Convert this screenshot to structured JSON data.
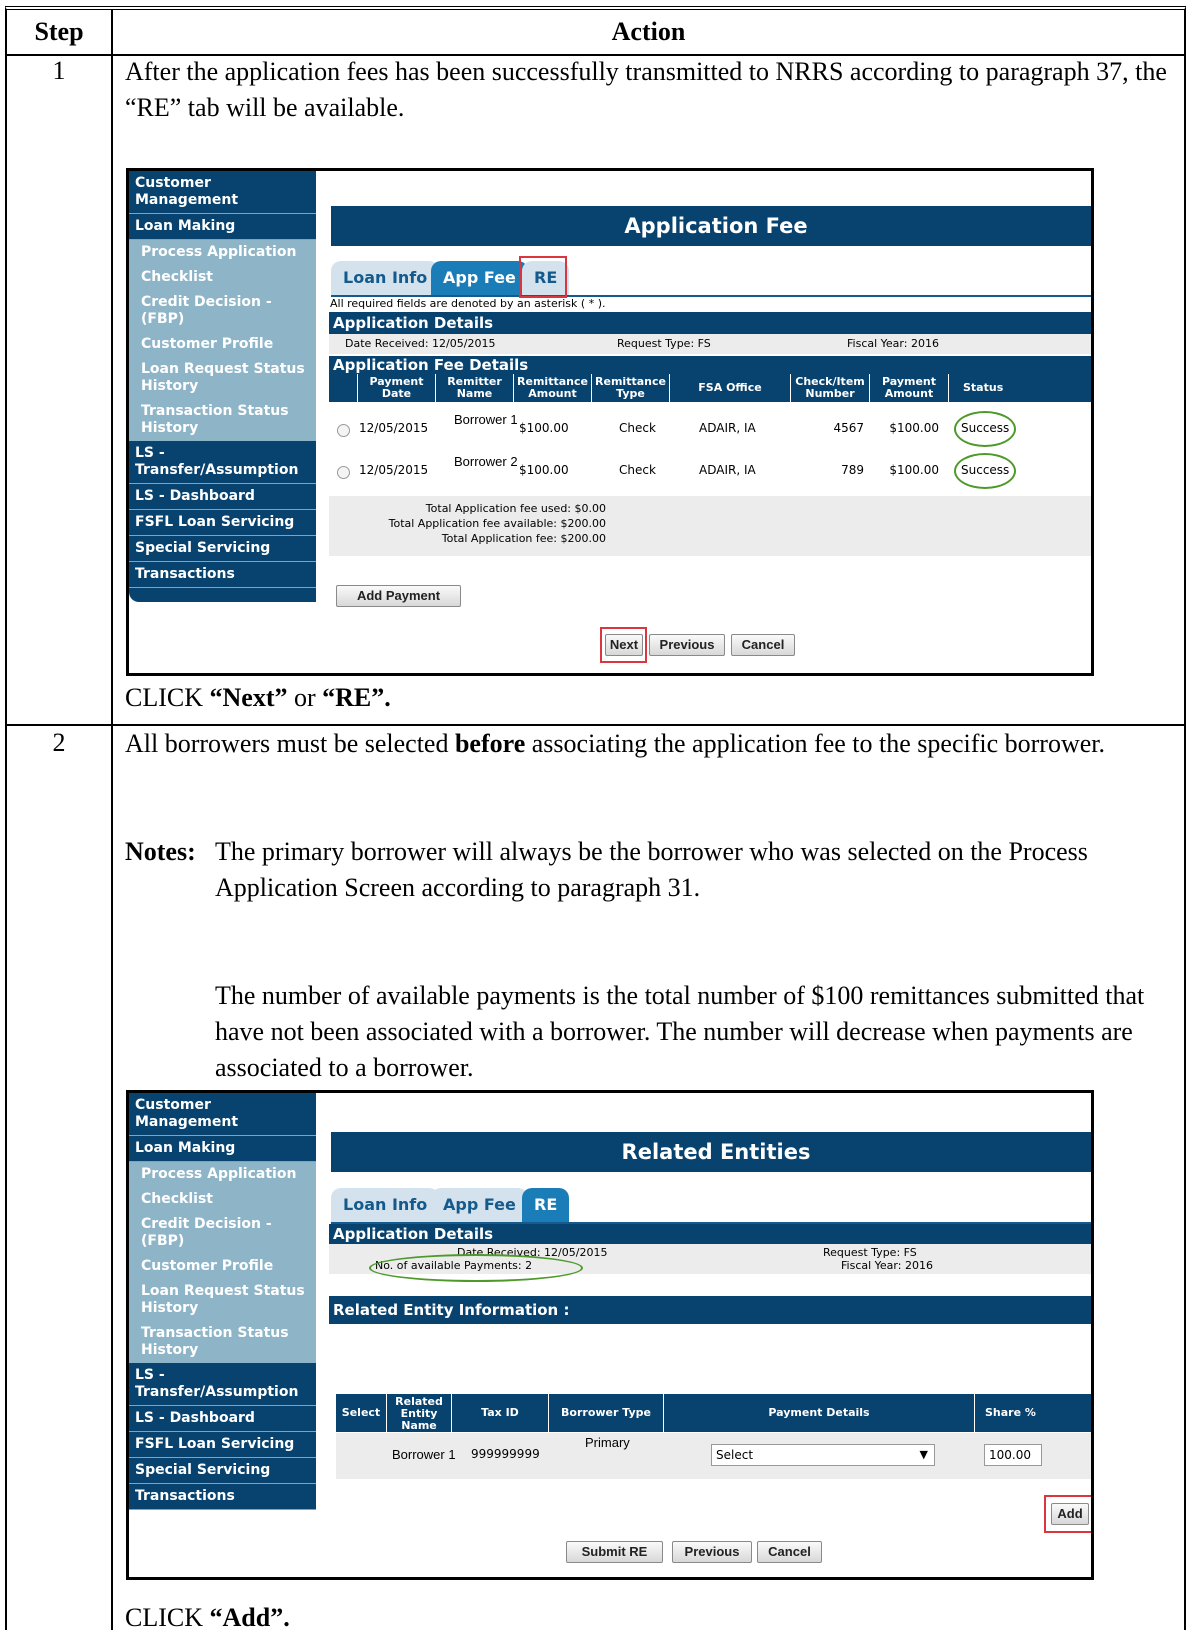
{
  "header": {
    "step": "Step",
    "action": "Action"
  },
  "step1": {
    "num": "1",
    "text": "After the application fees has been successfully transmitted to NRRS according to paragraph 37, the “RE” tab will be available.",
    "instr_prefix": "CLICK ",
    "instr_b1": "“Next”",
    "instr_mid": " or ",
    "instr_b2": "“RE”."
  },
  "step2": {
    "num": "2",
    "text_a": "All borrowers must be selected ",
    "text_b": "before",
    "text_c": " associating the application fee to the specific borrower.",
    "notes_label": "Notes:",
    "note1": "The primary borrower will always be the borrower who was selected on the Process Application Screen according to paragraph 31.",
    "note2": "The number of available payments is the total number of $100 remittances submitted that have not been associated with a borrower.  The number will decrease when payments are associated to a borrower.",
    "instr_prefix": "CLICK ",
    "instr_b": "“Add”."
  },
  "sidebar": {
    "customer_mgmt": "Customer Management",
    "loan_making": "Loan Making",
    "process_app": "Process Application",
    "checklist": "Checklist",
    "credit": "Credit Decision - (FBP)",
    "profile": "Customer Profile",
    "loan_req": "Loan Request Status History",
    "trans_status": "Transaction Status History",
    "ls_transfer": "LS - Transfer/Assumption",
    "ls_dash": "LS - Dashboard",
    "fsfl": "FSFL Loan Servicing",
    "special": "Special Servicing",
    "transactions": "Transactions"
  },
  "tabs": {
    "loan_info": "Loan Info",
    "app_fee": "App Fee",
    "re": "RE"
  },
  "screen1": {
    "title": "Application Fee",
    "required_note": "All required fields are denoted by an asterisk ( * ).",
    "app_details": "Application Details",
    "date_received": "Date Received:  12/05/2015",
    "request_type": "Request Type:  FS",
    "fiscal_year": "Fiscal Year:  2016",
    "fee_details": "Application Fee Details",
    "columns": [
      "Payment Date",
      "Remitter Name",
      "Remittance Amount",
      "Remittance Type",
      "FSA Office",
      "Check/Item Number",
      "Payment Amount",
      "Status"
    ],
    "rows": [
      [
        "12/05/2015",
        "Borrower 1",
        "$100.00",
        "Check",
        "ADAIR, IA",
        "4567",
        "$100.00",
        "Success"
      ],
      [
        "12/05/2015",
        "Borrower 2",
        "$100.00",
        "Check",
        "ADAIR, IA",
        "789",
        "$100.00",
        "Success"
      ]
    ],
    "total_used": "Total Application fee used: $0.00",
    "total_available": "Total Application fee available: $200.00",
    "total_fee": "Total Application fee: $200.00",
    "add_payment": "Add Payment",
    "next": "Next",
    "previous": "Previous",
    "cancel": "Cancel"
  },
  "screen2": {
    "title": "Related Entities",
    "app_details": "Application Details",
    "date_received": "Date Received: 12/05/2015",
    "available_payments": "No. of available Payments: 2",
    "request_type": "Request Type: FS",
    "fiscal_year": "Fiscal Year: 2016",
    "entity_info": "Related Entity Information :",
    "columns": [
      "Select",
      "Related Entity Name",
      "Tax ID",
      "Borrower Type",
      "Payment Details",
      "Share %"
    ],
    "row": {
      "name": "Borrower 1",
      "tax_id": "999999999",
      "type": "Primary",
      "payment": "Select",
      "share": "100.00"
    },
    "add": "Add",
    "submit": "Submit RE",
    "previous": "Previous",
    "cancel": "Cancel"
  }
}
